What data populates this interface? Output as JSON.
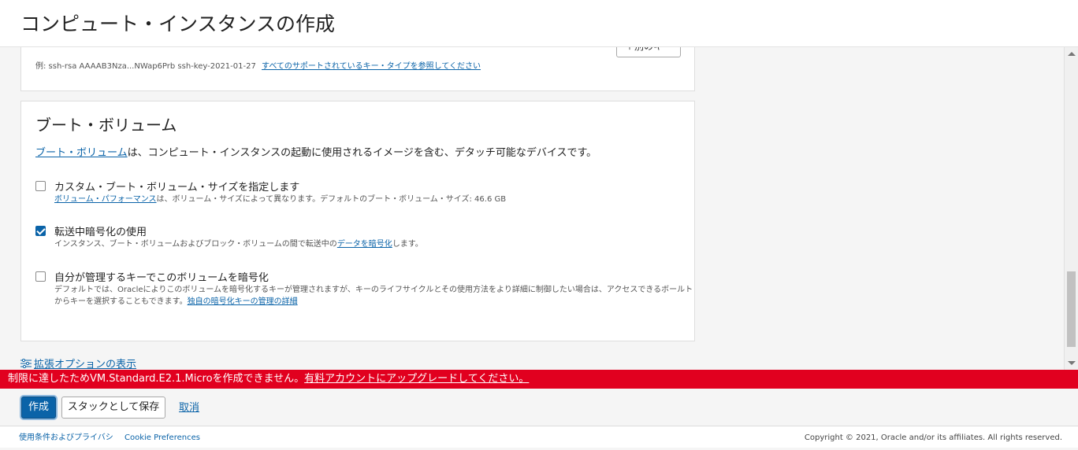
{
  "header": {
    "title": "コンピュート・インスタンスの作成"
  },
  "ssh_card": {
    "add_key_button": "＋別のキー",
    "example_text": "例: ssh-rsa AAAAB3Nza...NWap6Prb ssh-key-2021-01-27",
    "example_link": "すべてのサポートされているキー・タイプを参照してください"
  },
  "boot_volume": {
    "title": "ブート・ボリューム",
    "desc_link": "ブート・ボリューム",
    "desc_text": "は、コンピュート・インスタンスの起動に使用されるイメージを含む、デタッチ可能なデバイスです。",
    "options": [
      {
        "label": "カスタム・ブート・ボリューム・サイズを指定します",
        "checked": false,
        "help_link": "ボリューム・パフォーマンス",
        "help_text": "は、ボリューム・サイズによって異なります。デフォルトのブート・ボリューム・サイズ: 46.6 GB"
      },
      {
        "label": "転送中暗号化の使用",
        "checked": true,
        "help_text_pre": "インスタンス、ブート・ボリュームおよびブロック・ボリュームの間で転送中の",
        "help_link": "データを暗号化",
        "help_text_post": "します。"
      },
      {
        "label": "自分が管理するキーでこのボリュームを暗号化",
        "checked": false,
        "help_text": "デフォルトでは、Oracleによりこのボリュームを暗号化するキーが管理されますが、キーのライフサイクルとその使用方法をより詳細に制御したい場合は、アクセスできるボールトからキーを選択することもできます。",
        "help_link": "独自の暗号化キーの管理の詳細"
      }
    ]
  },
  "advanced_link": "拡張オプションの表示",
  "error_banner": {
    "text": "制限に達したためVM.Standard.E2.1.Microを作成できません。",
    "link": "有料アカウントにアップグレードしてください。"
  },
  "actions": {
    "create": "作成",
    "save_stack": "スタックとして保存",
    "cancel": "取消"
  },
  "footer": {
    "terms": "使用条件およびプライバシ",
    "cookie": "Cookie Preferences",
    "copyright": "Copyright © 2021, Oracle and/or its affiliates. All rights reserved."
  },
  "colors": {
    "accent": "#0a63a8",
    "error": "#e1001f"
  }
}
